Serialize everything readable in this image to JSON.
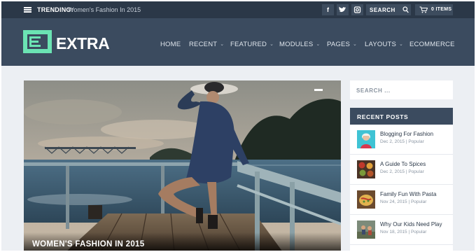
{
  "topbar": {
    "trending_label": "TRENDING:",
    "trending_text": "Women's Fashion In 2015",
    "social": [
      {
        "name": "facebook",
        "glyph": "f"
      },
      {
        "name": "twitter",
        "glyph": "t"
      },
      {
        "name": "instagram",
        "glyph": "◘"
      }
    ],
    "search_placeholder": "SEARCH",
    "cart_label": "0 ITEMS"
  },
  "header": {
    "logo_text": "EXTRA",
    "nav": [
      {
        "label": "HOME",
        "dropdown": false
      },
      {
        "label": "RECENT",
        "dropdown": true
      },
      {
        "label": "FEATURED",
        "dropdown": true
      },
      {
        "label": "MODULES",
        "dropdown": true
      },
      {
        "label": "PAGES",
        "dropdown": true
      },
      {
        "label": "LAYOUTS",
        "dropdown": true
      },
      {
        "label": "ECOMMERCE",
        "dropdown": false
      }
    ]
  },
  "hero": {
    "title": "WOMEN'S FASHION IN 2015"
  },
  "sidebar": {
    "search_placeholder": "SEARCH ...",
    "recent_title": "RECENT POSTS",
    "posts": [
      {
        "title": "Blogging For Fashion",
        "meta": "Dec 2, 2015 | Popular"
      },
      {
        "title": "A Guide To Spices",
        "meta": "Dec 2, 2015 | Popular"
      },
      {
        "title": "Family Fun With Pasta",
        "meta": "Nov 24, 2015 | Popular"
      },
      {
        "title": "Why Our Kids Need Play",
        "meta": "Nov 18, 2015 | Popular"
      }
    ]
  },
  "colors": {
    "topbar": "#2b3848",
    "header": "#3b4b5f",
    "accent": "#6be3b3",
    "page_bg": "#eceff3"
  }
}
